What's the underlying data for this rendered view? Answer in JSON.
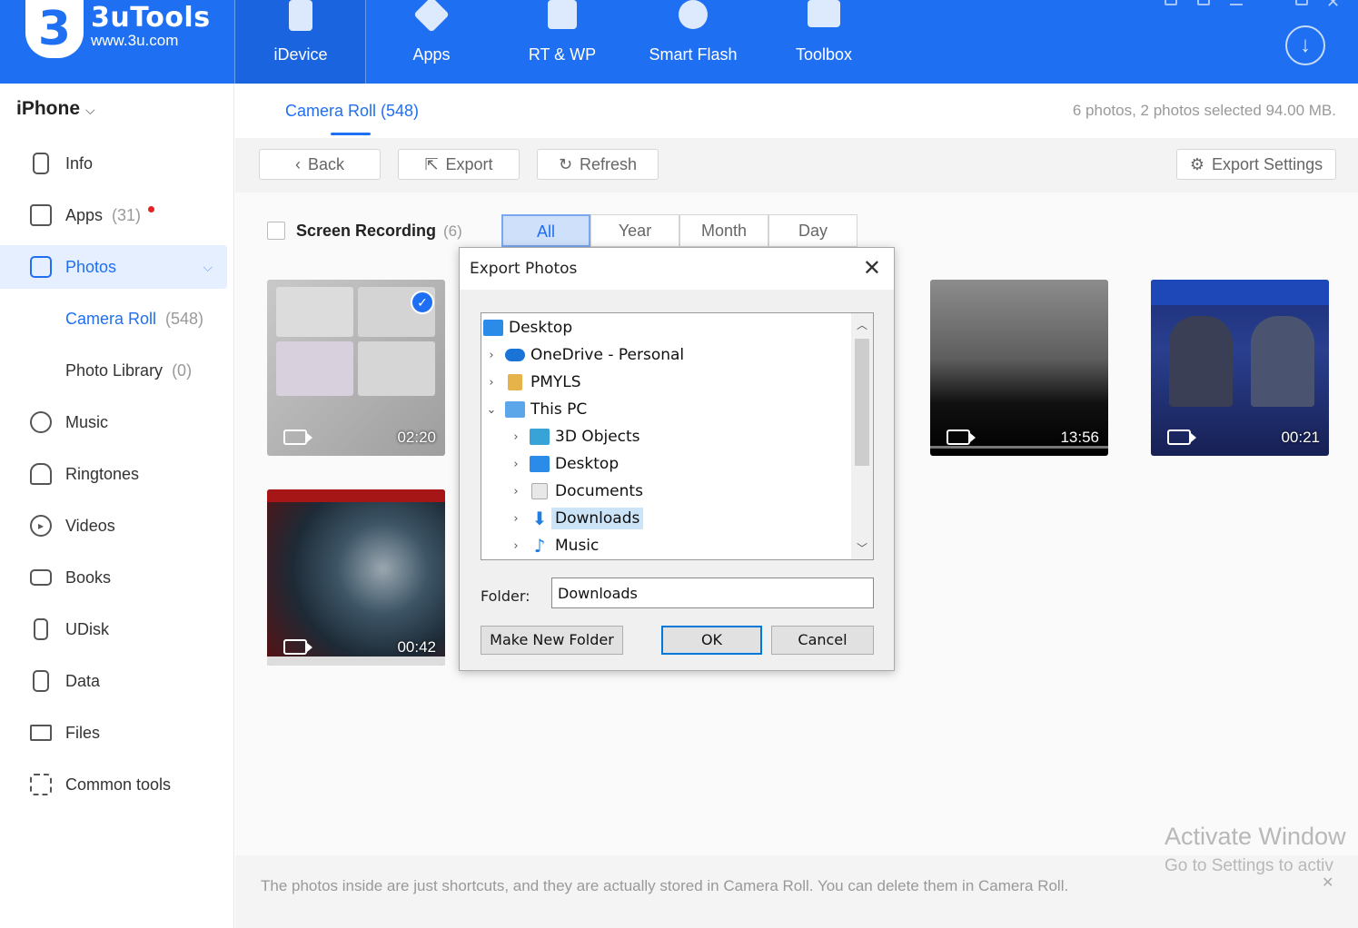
{
  "app": {
    "name": "3uTools",
    "url": "www.3u.com",
    "logo_glyph": "3"
  },
  "nav": [
    {
      "label": "iDevice",
      "icon": "phone-icon",
      "active": true
    },
    {
      "label": "Apps",
      "icon": "apps-box-icon"
    },
    {
      "label": "RT & WP",
      "icon": "music-note-icon"
    },
    {
      "label": "Smart Flash",
      "icon": "flash-icon"
    },
    {
      "label": "Toolbox",
      "icon": "toolbox-icon"
    }
  ],
  "sidebar": {
    "device": "iPhone",
    "items": [
      {
        "label": "Info",
        "icon": "info-icon"
      },
      {
        "label": "Apps",
        "count": "(31)",
        "icon": "apps-icon",
        "notification": true
      },
      {
        "label": "Photos",
        "icon": "photos-icon",
        "active": true
      },
      {
        "label": "Camera Roll",
        "count": "(548)",
        "sub": true,
        "active": true
      },
      {
        "label": "Photo Library",
        "count": "(0)",
        "sub": true
      },
      {
        "label": "Music",
        "icon": "music-icon"
      },
      {
        "label": "Ringtones",
        "icon": "bell-icon"
      },
      {
        "label": "Videos",
        "icon": "video-icon"
      },
      {
        "label": "Books",
        "icon": "book-icon"
      },
      {
        "label": "UDisk",
        "icon": "udisk-icon"
      },
      {
        "label": "Data",
        "icon": "data-icon"
      },
      {
        "label": "Files",
        "icon": "folder-icon"
      },
      {
        "label": "Common tools",
        "icon": "grid-icon"
      }
    ]
  },
  "main": {
    "tab": "Camera Roll (548)",
    "summary": "6 photos, 2 photos selected 94.00 MB.",
    "toolbar": {
      "back": "Back",
      "export": "Export",
      "refresh": "Refresh",
      "export_settings": "Export Settings"
    },
    "filter": {
      "label": "Screen Recording",
      "count": "(6)",
      "segments": [
        "All",
        "Year",
        "Month",
        "Day"
      ],
      "active": "All"
    },
    "thumbs": [
      {
        "duration": "02:20",
        "selected": true
      },
      {
        "duration": "00:42"
      },
      {
        "duration": "13:56"
      },
      {
        "duration": "00:21"
      }
    ],
    "footer_note": "The photos inside are just shortcuts, and they are actually stored in Camera Roll. You can delete them in Camera Roll."
  },
  "dialog": {
    "title": "Export Photos",
    "tree": [
      {
        "label": "Desktop",
        "level": 0,
        "toggle": ""
      },
      {
        "label": "OneDrive - Personal",
        "level": 1,
        "toggle": "›"
      },
      {
        "label": "PMYLS",
        "level": 1,
        "toggle": "›"
      },
      {
        "label": "This PC",
        "level": 1,
        "toggle": "⌄"
      },
      {
        "label": "3D Objects",
        "level": 2,
        "toggle": "›"
      },
      {
        "label": "Desktop",
        "level": 2,
        "toggle": "›"
      },
      {
        "label": "Documents",
        "level": 2,
        "toggle": "›"
      },
      {
        "label": "Downloads",
        "level": 2,
        "toggle": "›",
        "selected": true
      },
      {
        "label": "Music",
        "level": 2,
        "toggle": "›"
      }
    ],
    "folder_label": "Folder:",
    "folder_value": "Downloads",
    "make_new_folder": "Make New Folder",
    "ok": "OK",
    "cancel": "Cancel"
  },
  "watermark": {
    "line1": "Activate Window",
    "line2": "Go to Settings to activ"
  },
  "colors": {
    "accent": "#1f6ff2",
    "header": "#1f6ff2"
  }
}
